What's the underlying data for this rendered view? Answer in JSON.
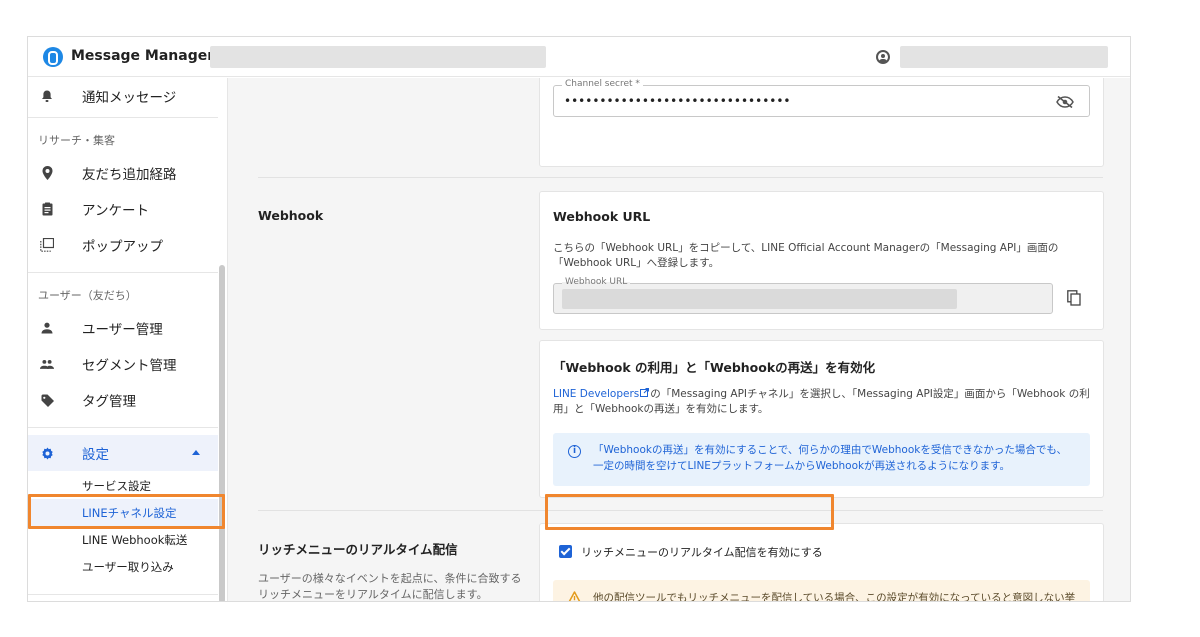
{
  "header": {
    "app_title": "Message Manager"
  },
  "sidebar": {
    "notify_label": "通知メッセージ",
    "section_research": "リサーチ・集客",
    "friend_route": "友だち追加経路",
    "survey": "アンケート",
    "popup": "ポップアップ",
    "section_users": "ユーザー（友だち）",
    "user_mgmt": "ユーザー管理",
    "segment_mgmt": "セグメント管理",
    "tag_mgmt": "タグ管理",
    "settings": "設定",
    "sub_items": {
      "service": "サービス設定",
      "line_channel": "LINEチャネル設定",
      "webhook_forward": "LINE Webhook転送",
      "user_import": "ユーザー取り込み"
    }
  },
  "channel_secret": {
    "label": "Channel secret *",
    "value": "••••••••••••••••••••••••••••••••"
  },
  "webhook": {
    "section_title": "Webhook",
    "card_title": "Webhook URL",
    "card_text": "こちらの「Webhook URL」をコピーして、LINE Official Account Managerの「Messaging API」画面の「Webhook URL」へ登録します。",
    "field_label": "Webhook URL",
    "enable_title": "「Webhook の利用」と「Webhookの再送」を有効化",
    "enable_link": "LINE Developers",
    "enable_text": "の「Messaging APIチャネル」を選択し、「Messaging API設定」画面から「Webhook の利用」と「Webhookの再送」を有効にします。",
    "info_text": "「Webhookの再送」を有効にすることで、何らかの理由でWebhookを受信できなかった場合でも、一定の時間を空けてLINEプラットフォームからWebhookが再送されるようになります。"
  },
  "richmenu": {
    "section_title": "リッチメニューのリアルタイム配信",
    "section_desc": "ユーザーの様々なイベントを起点に、条件に合致するリッチメニューをリアルタイムに配信します。",
    "checkbox_label": "リッチメニューのリアルタイム配信を有効にする",
    "checked": true,
    "warning_text": "他の配信ツールでもリッチメニューを配信している場合、この設定が有効になっていると意図しない挙動が発生する可能性があります。併用する場合は、設定を無効にしてください。"
  },
  "colors": {
    "accent": "#1e63d6",
    "highlight": "#f0862e",
    "info_bg": "#e8f2fc",
    "warn_bg": "#fdf3e3"
  }
}
